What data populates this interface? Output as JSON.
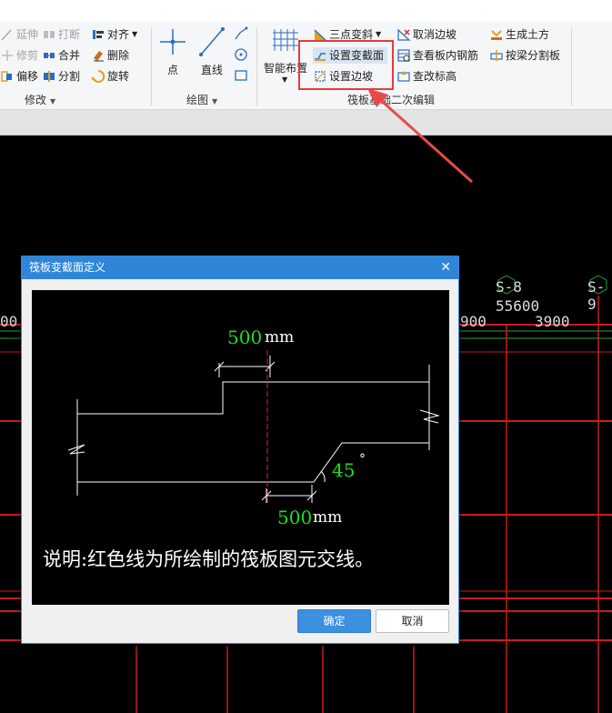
{
  "ribbon": {
    "modify": {
      "extend": "延伸",
      "break": "打断",
      "align": "对齐",
      "trim": "修剪",
      "merge": "合并",
      "delete": "删除",
      "offset": "偏移",
      "split": "分割",
      "rotate": "旋转",
      "group_label": "修改"
    },
    "draw": {
      "point": "点",
      "line": "直线",
      "group_label": "绘图"
    },
    "raft": {
      "smart_layout": "智能布置",
      "three_point_slope": "三点变斜",
      "set_section": "设置变截面",
      "set_edge_slope": "设置边坡",
      "cancel_edge_slope": "取消边坡",
      "view_rebar": "查看板内钢筋",
      "check_elevation": "查改标高",
      "generate_earthwork": "生成土方",
      "split_by_beam": "按梁分割板",
      "group_label": "筏板基础二次编辑"
    }
  },
  "canvas": {
    "axis_s8": "S-8",
    "axis_s9": "S-9",
    "dim_55600": "55600",
    "dim_3900": "3900",
    "dim_900": "900",
    "dim_left_00": "00"
  },
  "dialog": {
    "title": "筏板变截面定义",
    "fig": {
      "top_dim_value": "500",
      "top_dim_unit": "mm",
      "angle_value": "45",
      "angle_unit": "°",
      "bottom_dim_value": "500",
      "bottom_dim_unit": "mm",
      "note": "说明:红色线为所绘制的筏板图元交线。"
    },
    "ok_label": "确定",
    "cancel_label": "取消"
  },
  "colors": {
    "ribbon_bg": "#f5f6f7",
    "dialog_title": "#2f86d8",
    "ok_button": "#3d8fe0",
    "highlight": "#e63b3b",
    "grid_red": "#c81e1e",
    "grid_green": "#2ea12e",
    "dim_green": "#19e019"
  }
}
